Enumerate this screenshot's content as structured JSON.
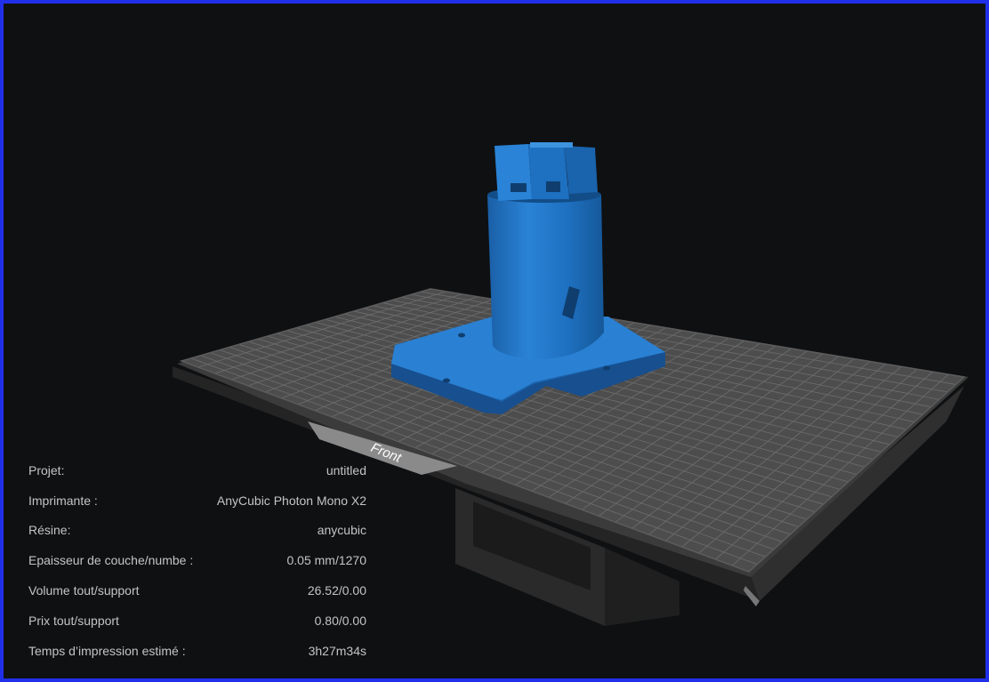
{
  "viewport": {
    "plate_label": "Front",
    "colors": {
      "background": "#0f1012",
      "model": "#1f72c4",
      "plate": "#4d4d4d",
      "grid": "#6e6e6e",
      "base": "#2b2b2b",
      "border": "#2030e8"
    }
  },
  "info": {
    "rows": [
      {
        "label": "Projet:",
        "value": "untitled"
      },
      {
        "label": "Imprimante :",
        "value": "AnyCubic Photon Mono X2"
      },
      {
        "label": "Résine:",
        "value": "anycubic"
      },
      {
        "label": "Epaisseur de couche/numbe :",
        "value": "0.05 mm/1270"
      },
      {
        "label": "Volume tout/support",
        "value": "26.52/0.00"
      },
      {
        "label": "Prix tout/support",
        "value": "0.80/0.00"
      },
      {
        "label": "Temps d’impression estimé :",
        "value": "3h27m34s"
      }
    ]
  }
}
